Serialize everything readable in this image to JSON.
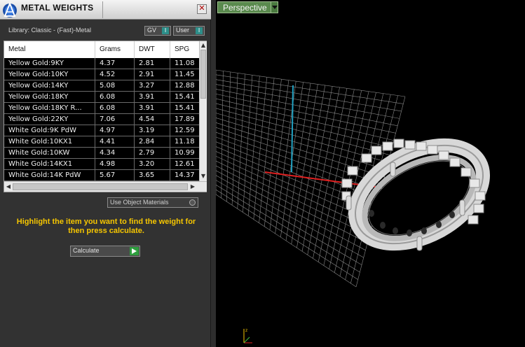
{
  "window": {
    "title": "METAL WEIGHTS",
    "close_label": "✕"
  },
  "library": {
    "label": "Library: Classic - (Fast)-Metal"
  },
  "toggles": {
    "gv": "GV",
    "user": "User"
  },
  "table": {
    "columns": [
      "Metal",
      "Grams",
      "DWT",
      "SPG"
    ],
    "rows": [
      [
        "Yellow Gold:9KY",
        "4.37",
        "2.81",
        "11.08"
      ],
      [
        "Yellow Gold:10KY",
        "4.52",
        "2.91",
        "11.45"
      ],
      [
        "Yellow Gold:14KY",
        "5.08",
        "3.27",
        "12.88"
      ],
      [
        "Yellow Gold:18KY",
        "6.08",
        "3.91",
        "15.41"
      ],
      [
        "Yellow Gold:18KY R...",
        "6.08",
        "3.91",
        "15.41"
      ],
      [
        "Yellow Gold:22KY",
        "7.06",
        "4.54",
        "17.89"
      ],
      [
        "White Gold:9K PdW",
        "4.97",
        "3.19",
        "12.59"
      ],
      [
        "White Gold:10KX1",
        "4.41",
        "2.84",
        "11.18"
      ],
      [
        "White Gold:10KW",
        "4.34",
        "2.79",
        "10.99"
      ],
      [
        "White Gold:14KX1",
        "4.98",
        "3.20",
        "12.61"
      ],
      [
        "White Gold:14K PdW",
        "5.67",
        "3.65",
        "14.37"
      ]
    ]
  },
  "options": {
    "use_object_materials": "Use Object Materials"
  },
  "hint": {
    "text": "Highlight the item you want to find the weight for then press calculate."
  },
  "calculate": {
    "label": "Calculate"
  },
  "viewport": {
    "view_label": "Perspective",
    "axis_colors": {
      "x": "#e02020",
      "y": "#20a0c0"
    },
    "grid_color": "#8a8a8a"
  },
  "colors": {
    "hint": "#f6c600",
    "accent": "#2d8f8a",
    "viewport_button": "#5a8a4e"
  }
}
